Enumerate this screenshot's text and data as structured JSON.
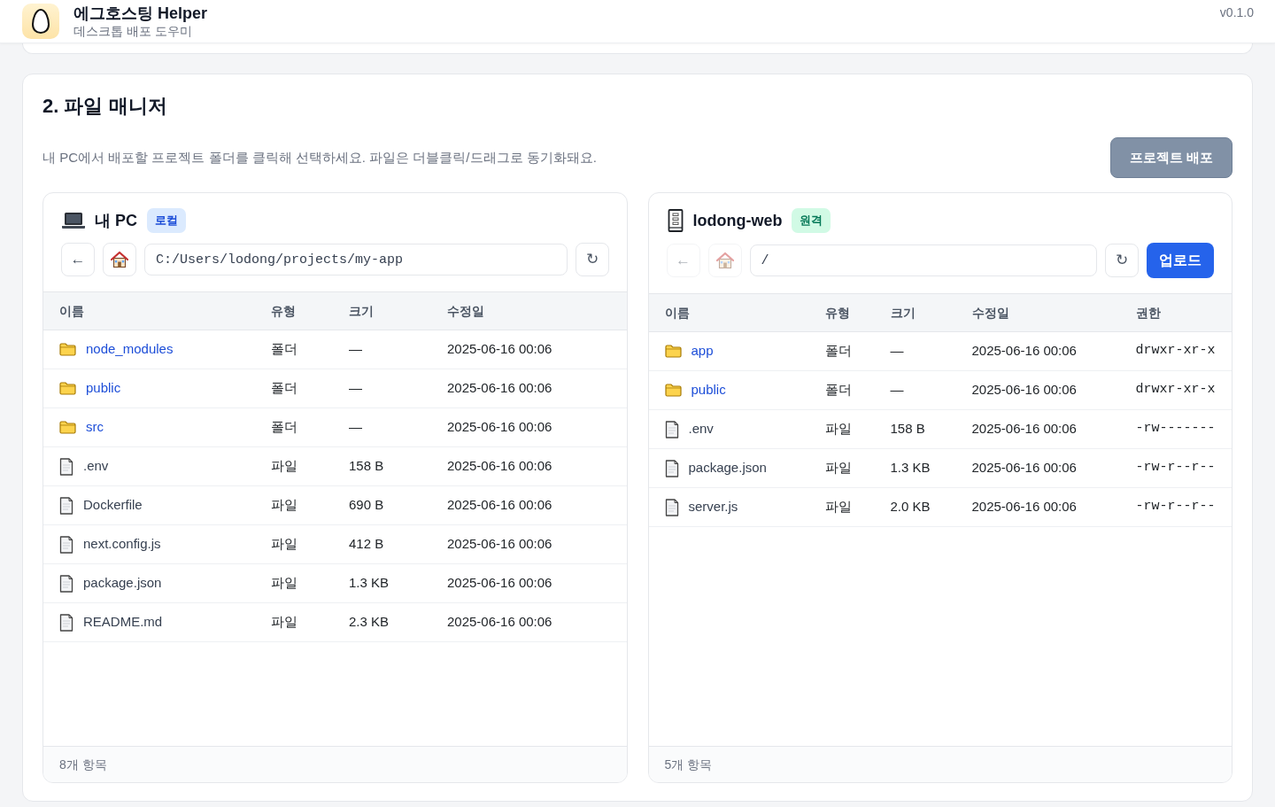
{
  "header": {
    "title": "에그호스팅 Helper",
    "subtitle": "데스크톱 배포 도우미",
    "version": "v0.1.0"
  },
  "section": {
    "title": "2. 파일 매니저",
    "description": "내 PC에서 배포할 프로젝트 폴더를 클릭해 선택하세요. 파일은 더블클릭/드래그로 동기화돼요.",
    "deploy_button": {
      "label": "프로젝트 배포",
      "disabled": true
    }
  },
  "panels": [
    {
      "kind": "local",
      "title": "내 PC",
      "badge": "로컬",
      "toolbar": {
        "back": {
          "label": "←",
          "disabled": false
        },
        "home": {
          "disabled": false
        },
        "path": "C:/Users/lodong/projects/my-app",
        "refresh": {
          "label": "↻"
        }
      },
      "columns": [
        "이름",
        "유형",
        "크기",
        "수정일"
      ],
      "rows": [
        {
          "kind": "folder",
          "cells": [
            "node_modules",
            "폴더",
            "—",
            "2025-06-16 00:06"
          ]
        },
        {
          "kind": "folder",
          "cells": [
            "public",
            "폴더",
            "—",
            "2025-06-16 00:06"
          ]
        },
        {
          "kind": "folder",
          "cells": [
            "src",
            "폴더",
            "—",
            "2025-06-16 00:06"
          ]
        },
        {
          "kind": "file",
          "cells": [
            ".env",
            "파일",
            "158 B",
            "2025-06-16 00:06"
          ]
        },
        {
          "kind": "file",
          "cells": [
            "Dockerfile",
            "파일",
            "690 B",
            "2025-06-16 00:06"
          ]
        },
        {
          "kind": "file",
          "cells": [
            "next.config.js",
            "파일",
            "412 B",
            "2025-06-16 00:06"
          ]
        },
        {
          "kind": "file",
          "cells": [
            "package.json",
            "파일",
            "1.3 KB",
            "2025-06-16 00:06"
          ]
        },
        {
          "kind": "file",
          "cells": [
            "README.md",
            "파일",
            "2.3 KB",
            "2025-06-16 00:06"
          ]
        }
      ],
      "footer": "8개 항목"
    },
    {
      "kind": "remote",
      "title": "lodong-web",
      "badge": "원격",
      "toolbar": {
        "back": {
          "label": "←",
          "disabled": true
        },
        "home": {
          "disabled": true
        },
        "path": "/",
        "refresh": {
          "label": "↻"
        },
        "upload": {
          "label": "업로드"
        }
      },
      "columns": [
        "이름",
        "유형",
        "크기",
        "수정일",
        "권한"
      ],
      "rows": [
        {
          "kind": "folder",
          "cells": [
            "app",
            "폴더",
            "—",
            "2025-06-16 00:06",
            "drwxr-xr-x"
          ]
        },
        {
          "kind": "folder",
          "cells": [
            "public",
            "폴더",
            "—",
            "2025-06-16 00:06",
            "drwxr-xr-x"
          ]
        },
        {
          "kind": "file",
          "cells": [
            ".env",
            "파일",
            "158 B",
            "2025-06-16 00:06",
            "-rw-------"
          ]
        },
        {
          "kind": "file",
          "cells": [
            "package.json",
            "파일",
            "1.3 KB",
            "2025-06-16 00:06",
            "-rw-r--r--"
          ]
        },
        {
          "kind": "file",
          "cells": [
            "server.js",
            "파일",
            "2.0 KB",
            "2025-06-16 00:06",
            "-rw-r--r--"
          ]
        }
      ],
      "footer": "5개 항목"
    }
  ]
}
